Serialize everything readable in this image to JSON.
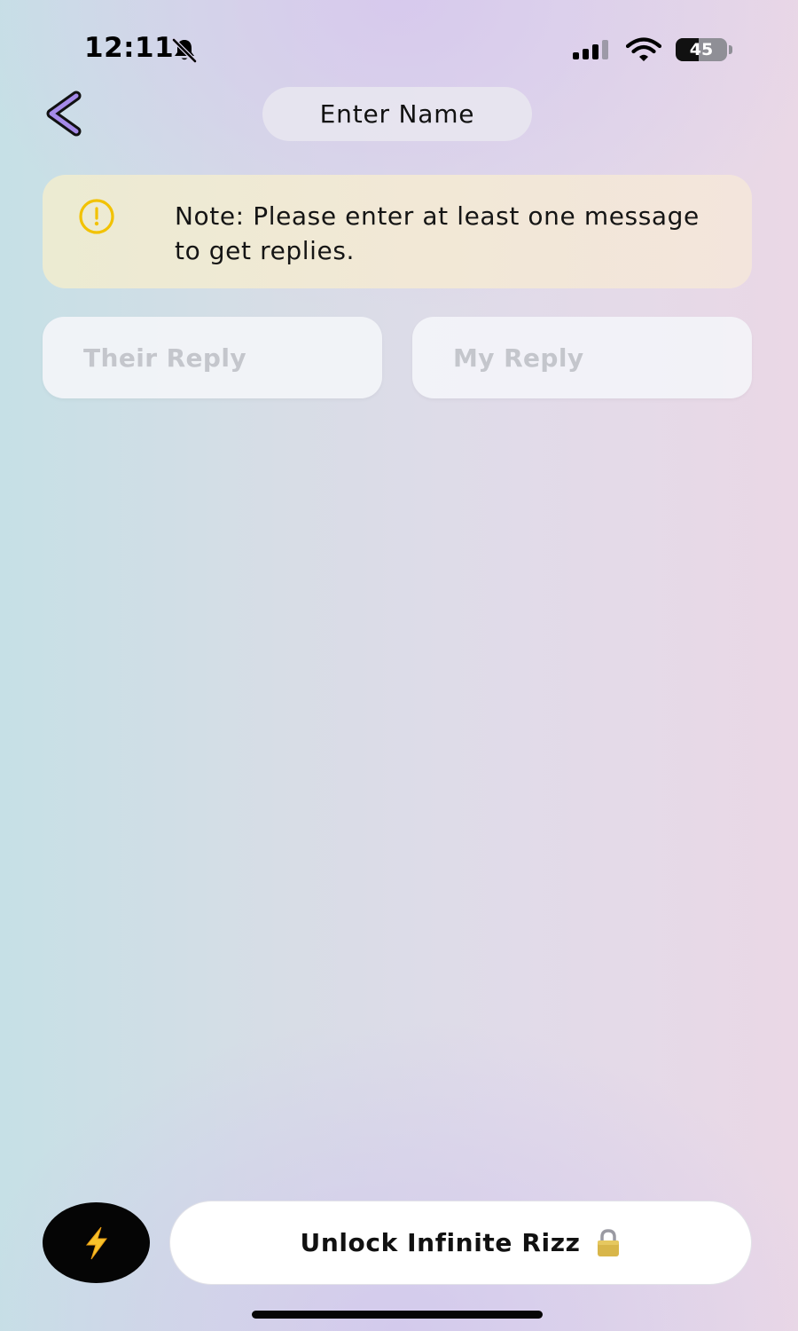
{
  "status_bar": {
    "time": "12:11",
    "battery_level": "45",
    "battery_fraction": 0.45
  },
  "header": {
    "back_icon": "chevron-left-icon",
    "name_title": "Enter Name"
  },
  "note": {
    "icon": "warning-icon",
    "text": "Note: Please enter at least one message to get replies."
  },
  "reply_buttons": {
    "their": "Their Reply",
    "mine": "My Reply"
  },
  "actions": {
    "bolt_icon": "lightning-bolt-icon",
    "unlock_label": "Unlock Infinite Rizz",
    "lock_icon": "padlock-icon"
  },
  "colors": {
    "warning": "#f2c200",
    "back_chevron": "#a58ae8",
    "bolt": "#f7c22b",
    "bolt_button": "#050505"
  }
}
